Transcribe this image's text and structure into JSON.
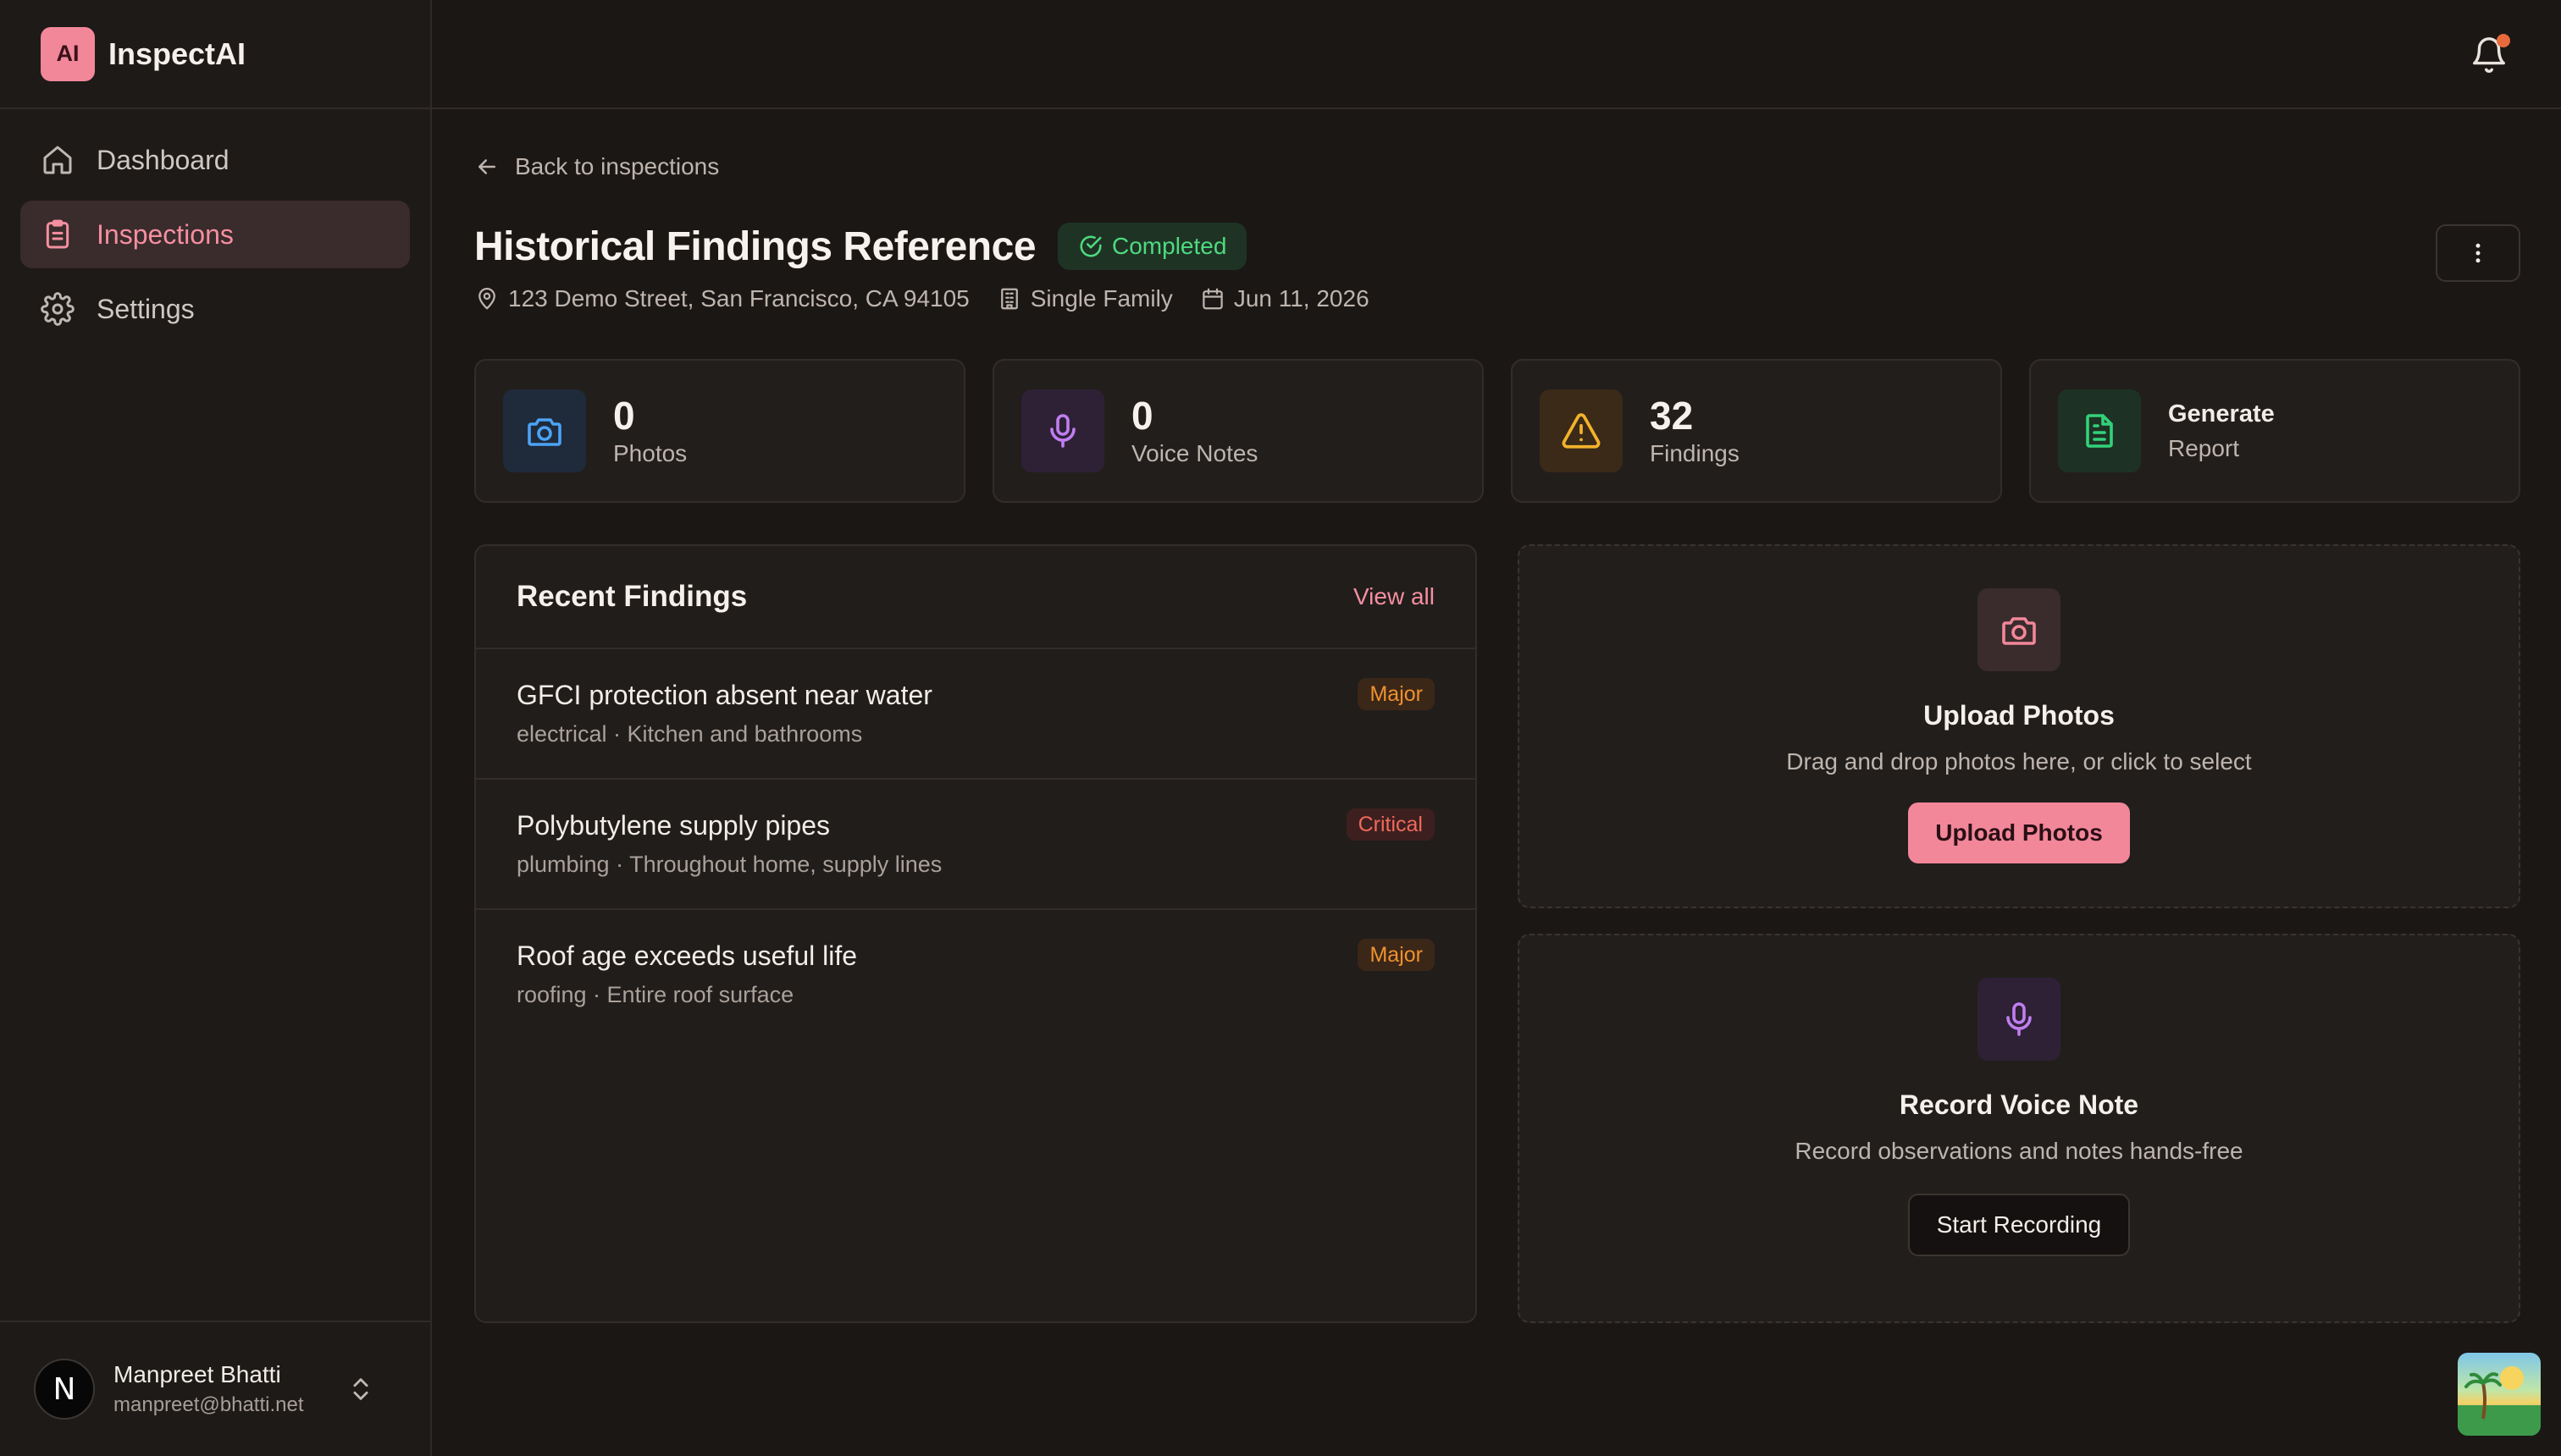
{
  "brand": {
    "logo_text": "AI",
    "name": "InspectAI"
  },
  "sidebar": {
    "items": [
      {
        "label": "Dashboard",
        "icon": "home-icon",
        "active": false
      },
      {
        "label": "Inspections",
        "icon": "clipboard-icon",
        "active": true
      },
      {
        "label": "Settings",
        "icon": "gear-icon",
        "active": false
      }
    ]
  },
  "user": {
    "initial": "N",
    "name": "Manpreet Bhatti",
    "email": "manpreet@bhatti.net"
  },
  "header": {
    "back_label": "Back to inspections",
    "notification_icon": "bell-icon"
  },
  "inspection": {
    "title": "Historical Findings Reference",
    "status": "Completed",
    "address": "123 Demo Street, San Francisco, CA 94105",
    "property_type": "Single Family",
    "date": "Jun 11, 2026"
  },
  "stats": [
    {
      "value": "0",
      "label": "Photos",
      "icon": "camera-icon",
      "color": "#4ba3f5"
    },
    {
      "value": "0",
      "label": "Voice Notes",
      "icon": "microphone-icon",
      "color": "#c07ef0"
    },
    {
      "value": "32",
      "label": "Findings",
      "icon": "warning-icon",
      "color": "#f2b22c"
    }
  ],
  "generate": {
    "title": "Generate",
    "subtitle": "Report",
    "icon": "document-icon",
    "color": "#33d17a"
  },
  "recent_findings": {
    "title": "Recent Findings",
    "view_all": "View all",
    "items": [
      {
        "title": "GFCI protection absent near water",
        "subtitle": "electrical · Kitchen and bathrooms",
        "severity": "Major"
      },
      {
        "title": "Polybutylene supply pipes",
        "subtitle": "plumbing · Throughout home, supply lines",
        "severity": "Critical"
      },
      {
        "title": "Roof age exceeds useful life",
        "subtitle": "roofing · Entire roof surface",
        "severity": "Major"
      }
    ]
  },
  "upload": {
    "title": "Upload Photos",
    "description": "Drag and drop photos here, or click to select",
    "button": "Upload Photos"
  },
  "voice": {
    "title": "Record Voice Note",
    "description": "Record observations and notes hands-free",
    "button": "Start Recording"
  },
  "colors": {
    "accent": "#f2879a",
    "background": "#1b1715",
    "success": "#4ddb7f",
    "major": "#f0912f",
    "critical": "#f06a5a"
  }
}
